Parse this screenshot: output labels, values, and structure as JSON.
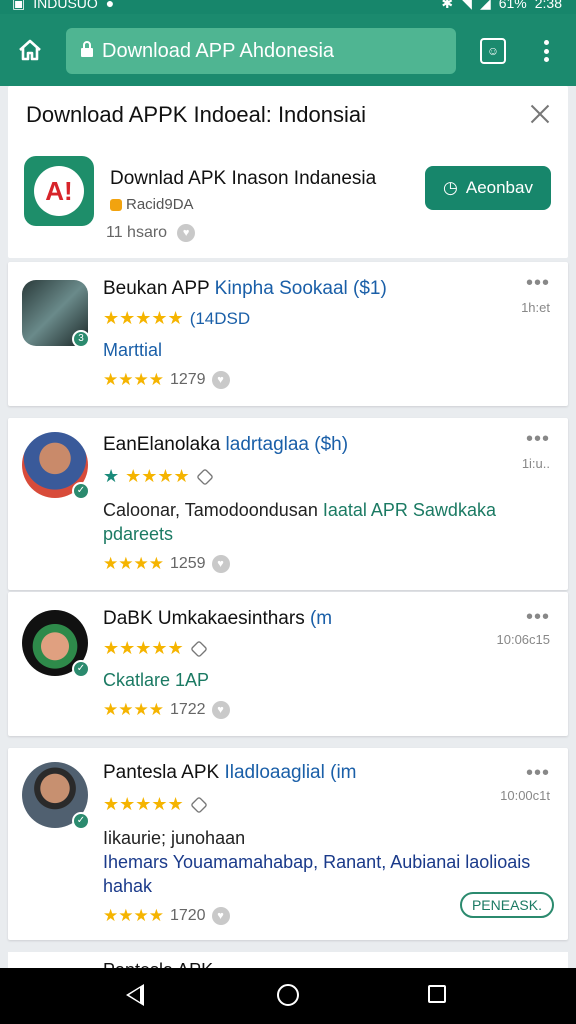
{
  "status_bar": {
    "carrier": "INDUSUO",
    "battery": "61%",
    "time": "2:38"
  },
  "browser": {
    "url_text": "Download APP Ahdonesia",
    "home_icon": "home-icon",
    "lock_icon": "lock-icon",
    "tab_icon": "tab-switch-icon",
    "menu_icon": "more-vert-icon"
  },
  "header": {
    "title": "Download APPK Indoeal: Indonsiai",
    "app_name": "Downlad APK Inason Indanesia",
    "publisher": "Racid9DA",
    "meta": "11 hsaro",
    "download_label": "Aeonbav"
  },
  "items": [
    {
      "title": "Beukan APP",
      "title_accent": "Kinpha Sookaal ($1)",
      "stars_text": "(14DSD",
      "time": "1h:et",
      "link": "Marttial",
      "rating_count": "1279"
    },
    {
      "title": "EanElanolaka",
      "title_accent": "ladrtaglaa ($h)",
      "time": "1i:u..",
      "body": "Caloonar, Tamodoondusan",
      "body_accent": "Iaatal APR Sawdkaka",
      "body2_accent": "pdareets",
      "rating_count": "1259"
    },
    {
      "title": "DaBK Umkakaesinthars",
      "title_accent": "(m",
      "time": "10:06c15",
      "link": "Ckatlare 1AP",
      "rating_count": "1722"
    },
    {
      "title": "Pantesla APK",
      "title_accent": "Iladloaaglial (im",
      "time": "10:00c1t",
      "body": "Iikaurie; junohaan",
      "body2": "Ihemars Youamamahabap, Ranant, Aubianai laolioais",
      "body3": "hahak",
      "rating_count": "1720",
      "pill": "PENEASK."
    }
  ],
  "peek": {
    "text": "Pantesla APK"
  },
  "colors": {
    "primary": "#1b8a6e",
    "accent_blue": "#1a5fa8",
    "star": "#f5b400"
  }
}
